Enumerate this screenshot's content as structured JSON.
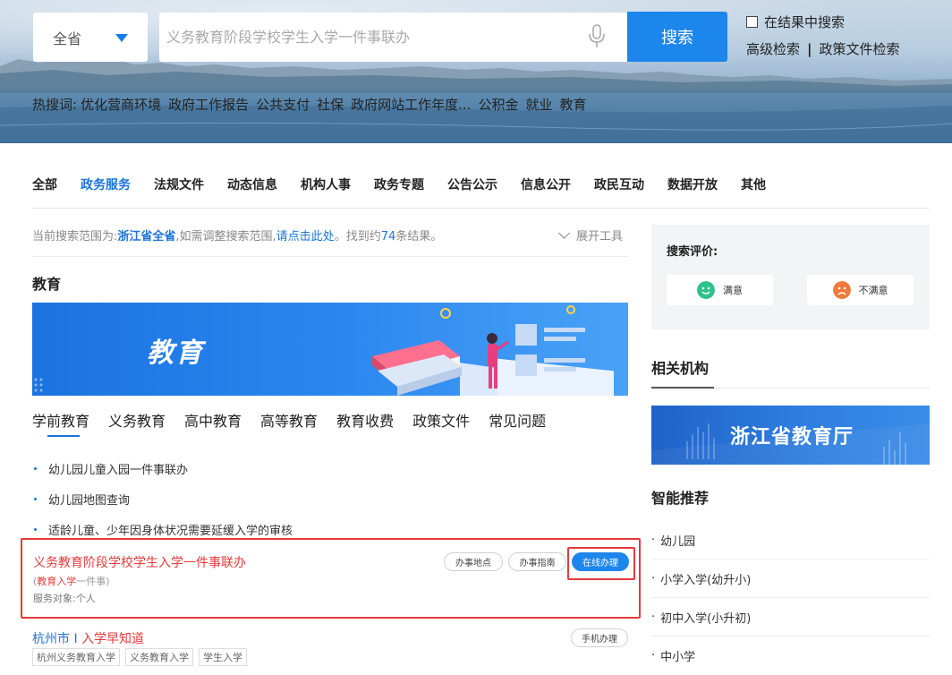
{
  "search": {
    "region": "全省",
    "placeholder": "义务教育阶段学校学生入学一件事联办",
    "button": "搜索",
    "within_results": "在结果中搜索",
    "advanced": "高级检索",
    "separator": "|",
    "policy_search": "政策文件检索"
  },
  "hot": {
    "label": "热搜词:",
    "words": [
      "优化营商环境",
      "政府工作报告",
      "公共支付",
      "社保",
      "政府网站工作年度...",
      "公积金",
      "就业",
      "教育"
    ]
  },
  "tabs": [
    "全部",
    "政务服务",
    "法规文件",
    "动态信息",
    "机构人事",
    "政务专题",
    "公告公示",
    "信息公开",
    "政民互动",
    "数据开放",
    "其他"
  ],
  "active_tab": "政务服务",
  "scope": {
    "prefix": "当前搜索范围为:",
    "region": "浙江省全省",
    "middle": ",如需调整搜索范围,",
    "link": "请点击此处",
    "suffix_a": "。找到约",
    "count": "74",
    "suffix_b": "条结果。",
    "expand": "展开工具"
  },
  "education": {
    "section_title": "教育",
    "banner_label": "教育",
    "sub_tabs": [
      "学前教育",
      "义务教育",
      "高中教育",
      "高等教育",
      "教育收费",
      "政策文件",
      "常见问题"
    ],
    "items": [
      "幼儿园儿童入园一件事联办",
      "幼儿园地图查询",
      "适龄儿童、少年因身体状况需要延缓入学的审核"
    ]
  },
  "result": {
    "title": "义务教育阶段学校学生入学一件事联办",
    "tag_open": "(",
    "tag_main": "教育入学",
    "tag_sub": "一件事)",
    "object": "服务对象:个人",
    "btn_location": "办事地点",
    "btn_guide": "办事指南",
    "btn_online": "在线办理"
  },
  "result2": {
    "city": "杭州市",
    "sep": " I ",
    "title": "入学早知道",
    "btn_mobile": "手机办理",
    "tags": [
      "杭州义务教育入学",
      "义务教育入学",
      "学生入学"
    ]
  },
  "sidebar": {
    "rating_title": "搜索评价:",
    "satisfied": "满意",
    "unsatisfied": "不满意",
    "agency_title": "相关机构",
    "agency_name": "浙江省教育厅",
    "rec_title": "智能推荐",
    "rec_items": [
      "幼儿园",
      "小学入学(幼升小)",
      "初中入学(小升初)",
      "中小学"
    ]
  },
  "colors": {
    "accent": "#1a73d9",
    "button": "#1d86ec",
    "highlight": "#e53a3a",
    "satisfied": "#2ec28a",
    "unsatisfied": "#f07a3a"
  }
}
